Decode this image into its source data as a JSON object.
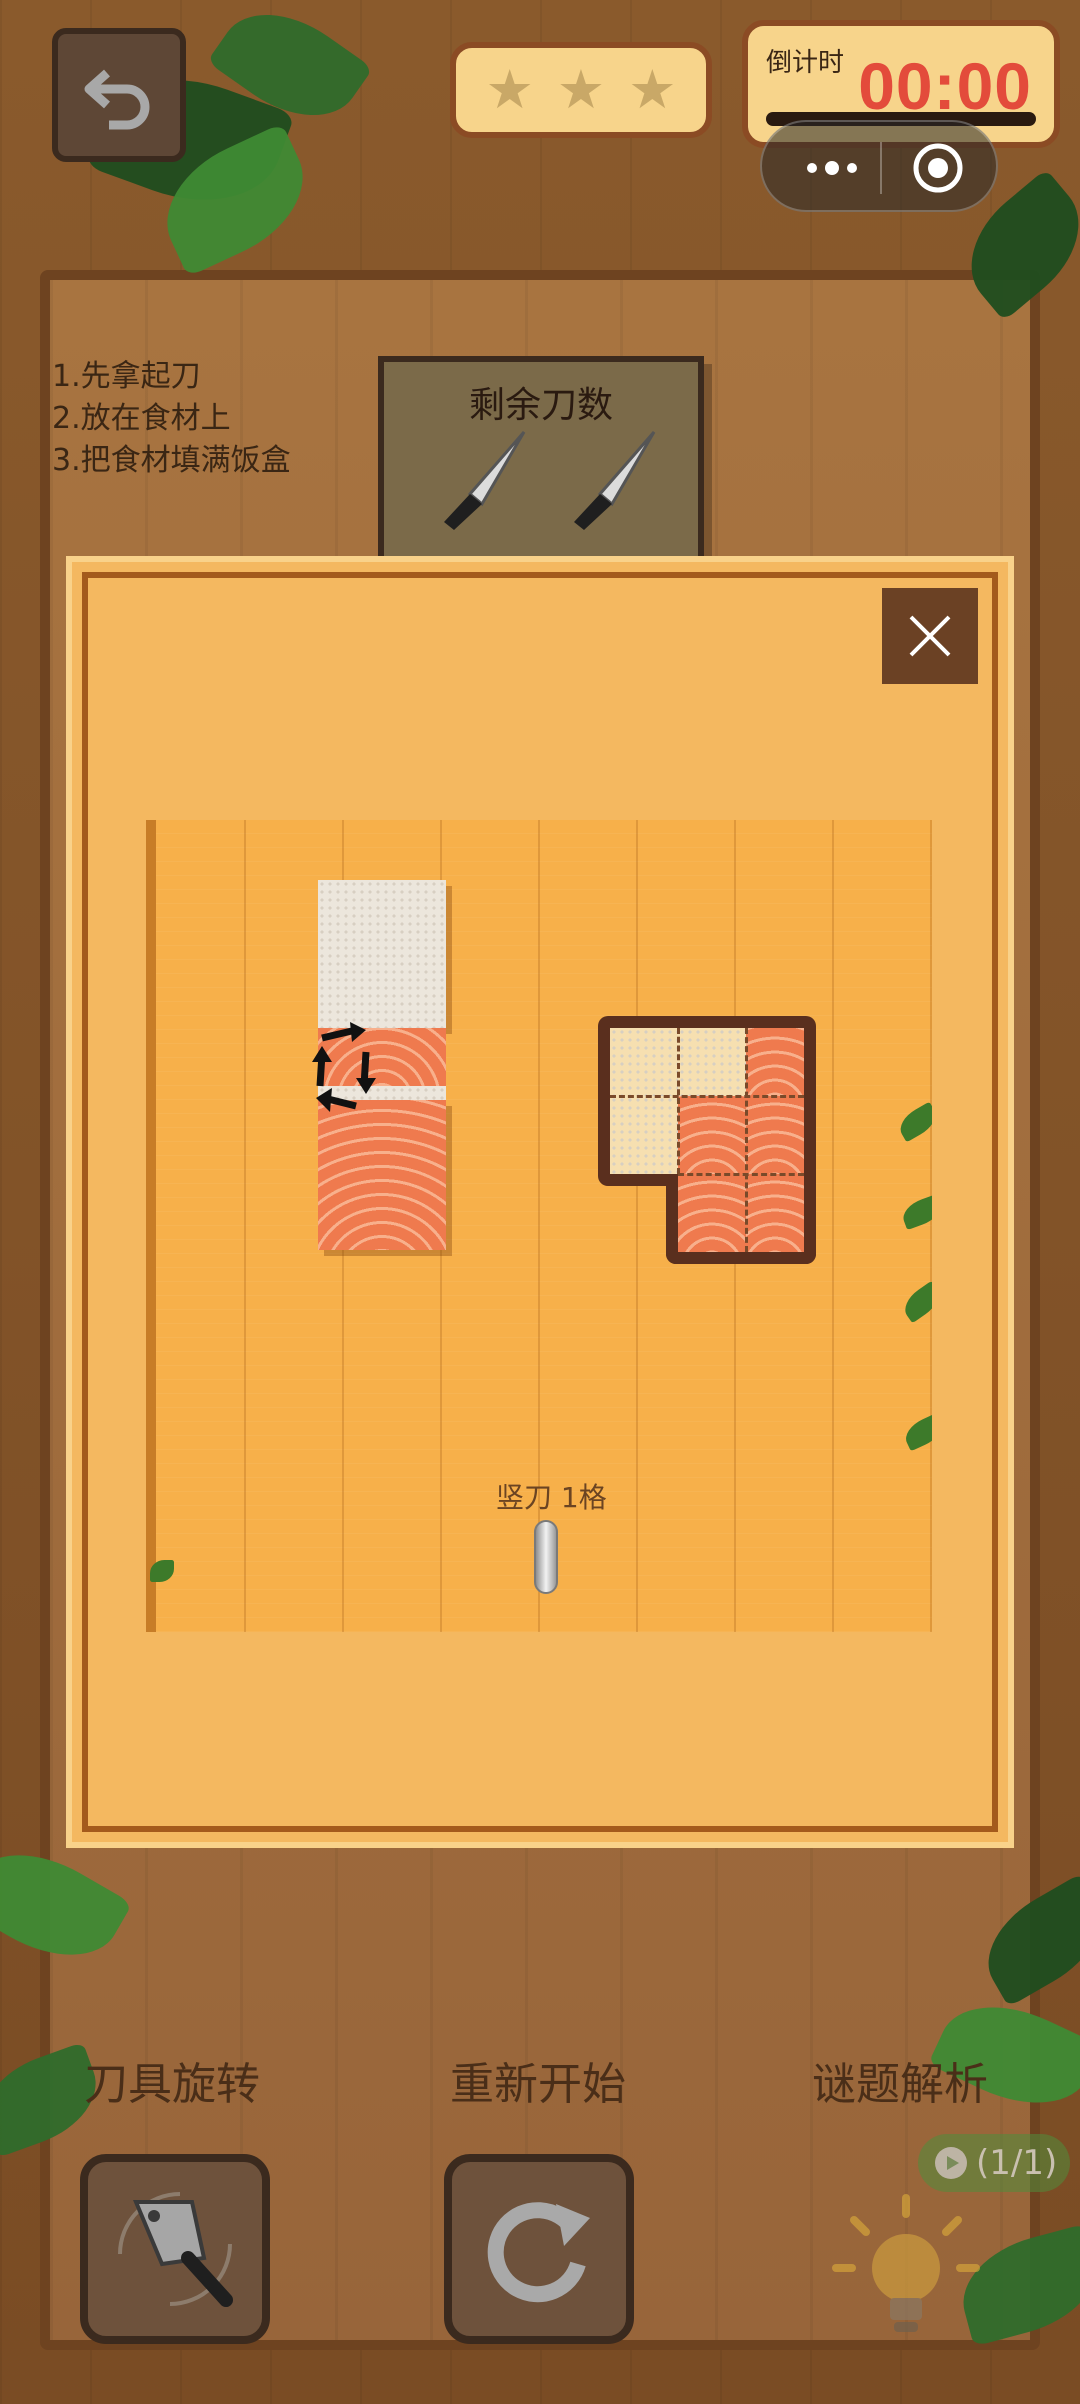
{
  "header": {
    "stars": [
      "★",
      "★",
      "★"
    ],
    "timer_label": "倒计时",
    "timer_value": "00:00"
  },
  "instructions": [
    "1.先拿起刀",
    "2.放在食材上",
    "3.把食材填满饭盒"
  ],
  "knife_panel": {
    "title": "剩余刀数",
    "remaining_knives": 2
  },
  "modal": {
    "hint_label": "竖刀 1格"
  },
  "controls": {
    "rotate_label": "刀具旋转",
    "restart_label": "重新开始",
    "solution_label": "谜题解析",
    "video_count": "(1/1)"
  },
  "colors": {
    "timer_text": "#e34b3b",
    "panel_fill": "#f7d48b",
    "modal_fill": "#f4b860"
  }
}
